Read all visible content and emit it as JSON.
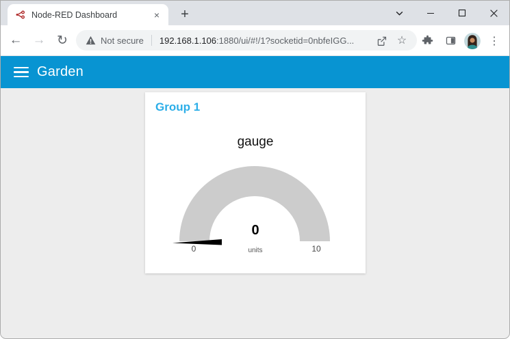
{
  "browser": {
    "tab_title": "Node-RED Dashboard",
    "tab_close": "×",
    "new_tab": "+",
    "address": {
      "security_text": "Not secure",
      "url_host": "192.168.1.106",
      "url_rest": ":1880/ui/#!/1?socketid=0nbfeIGG..."
    },
    "icons": {
      "back": "←",
      "forward": "→",
      "reload": "↻",
      "star": "☆",
      "kebab": "⋮"
    }
  },
  "dashboard": {
    "header_title": "Garden",
    "group": {
      "title": "Group 1",
      "widget_title": "gauge"
    }
  },
  "chart_data": {
    "type": "gauge",
    "title": "gauge",
    "value": 0,
    "min": 0,
    "max": 10,
    "units": "units",
    "arc_color": "#cccccc",
    "needle_color": "#000000",
    "value_color": "#000000"
  },
  "colors": {
    "header_bg": "#0894d2",
    "group_title": "#2caee8",
    "content_bg": "#ededed",
    "tabstrip_bg": "#dee1e6"
  }
}
